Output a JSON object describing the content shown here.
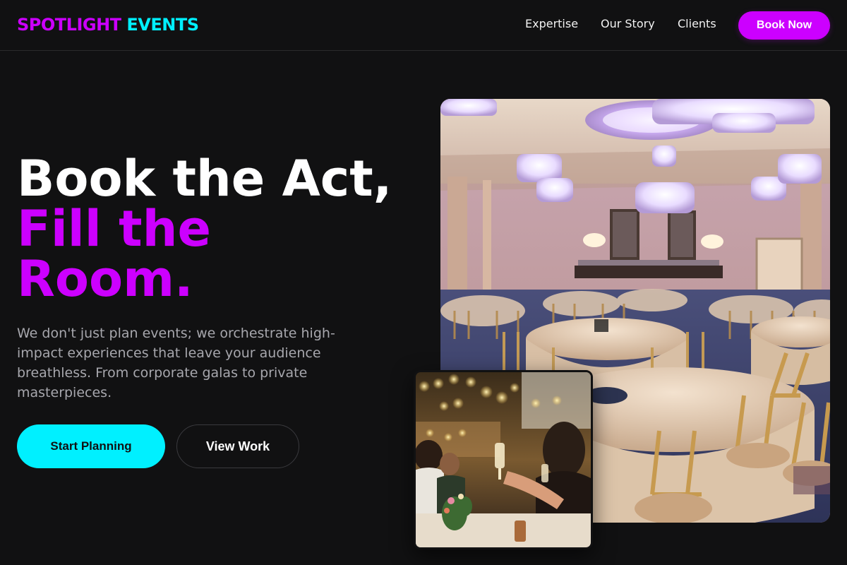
{
  "brand": {
    "part1": "SPOTLIGHT",
    "part2": "EVENTS"
  },
  "nav": {
    "expertise": "Expertise",
    "story": "Our Story",
    "clients": "Clients",
    "cta": "Book Now"
  },
  "hero": {
    "title_line1": "Book the Act,",
    "title_line2": "Fill the Room.",
    "description": "We don't just plan events; we orchestrate high-impact experiences that leave your audience breathless. From corporate galas to private masterpieces.",
    "primary_button": "Start Planning",
    "secondary_button": "View Work"
  },
  "images": {
    "main": "ballroom-photo",
    "inset": "celebration-toast-photo"
  },
  "colors": {
    "background": "#111112",
    "magenta": "#cc00ff",
    "cyan": "#00f0ff",
    "muted_text": "#a7a7ad"
  }
}
